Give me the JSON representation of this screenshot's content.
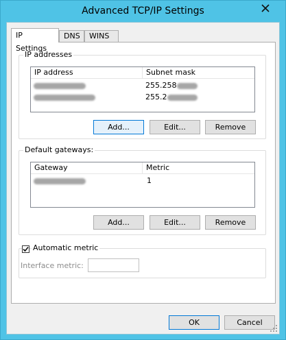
{
  "window": {
    "title": "Advanced TCP/IP Settings"
  },
  "tabs": [
    {
      "label": "IP Settings"
    },
    {
      "label": "DNS"
    },
    {
      "label": "WINS"
    }
  ],
  "ip_addresses": {
    "title": "IP addresses",
    "columns": [
      "IP address",
      "Subnet mask"
    ],
    "rows": [
      {
        "ip": "",
        "mask": "255.258"
      },
      {
        "ip": "",
        "mask": "255.2"
      }
    ],
    "buttons": {
      "add": "Add...",
      "edit": "Edit...",
      "remove": "Remove"
    }
  },
  "gateways": {
    "title": "Default gateways:",
    "columns": [
      "Gateway",
      "Metric"
    ],
    "rows": [
      {
        "gateway": "",
        "metric": "1"
      }
    ],
    "buttons": {
      "add": "Add...",
      "edit": "Edit...",
      "remove": "Remove"
    }
  },
  "metric": {
    "checkbox_label": "Automatic metric",
    "checked": true,
    "interface_label": "Interface metric:",
    "interface_value": ""
  },
  "dialog": {
    "ok": "OK",
    "cancel": "Cancel"
  },
  "colors": {
    "accent": "#0078d7",
    "titlebar": "#4fc3e6"
  }
}
